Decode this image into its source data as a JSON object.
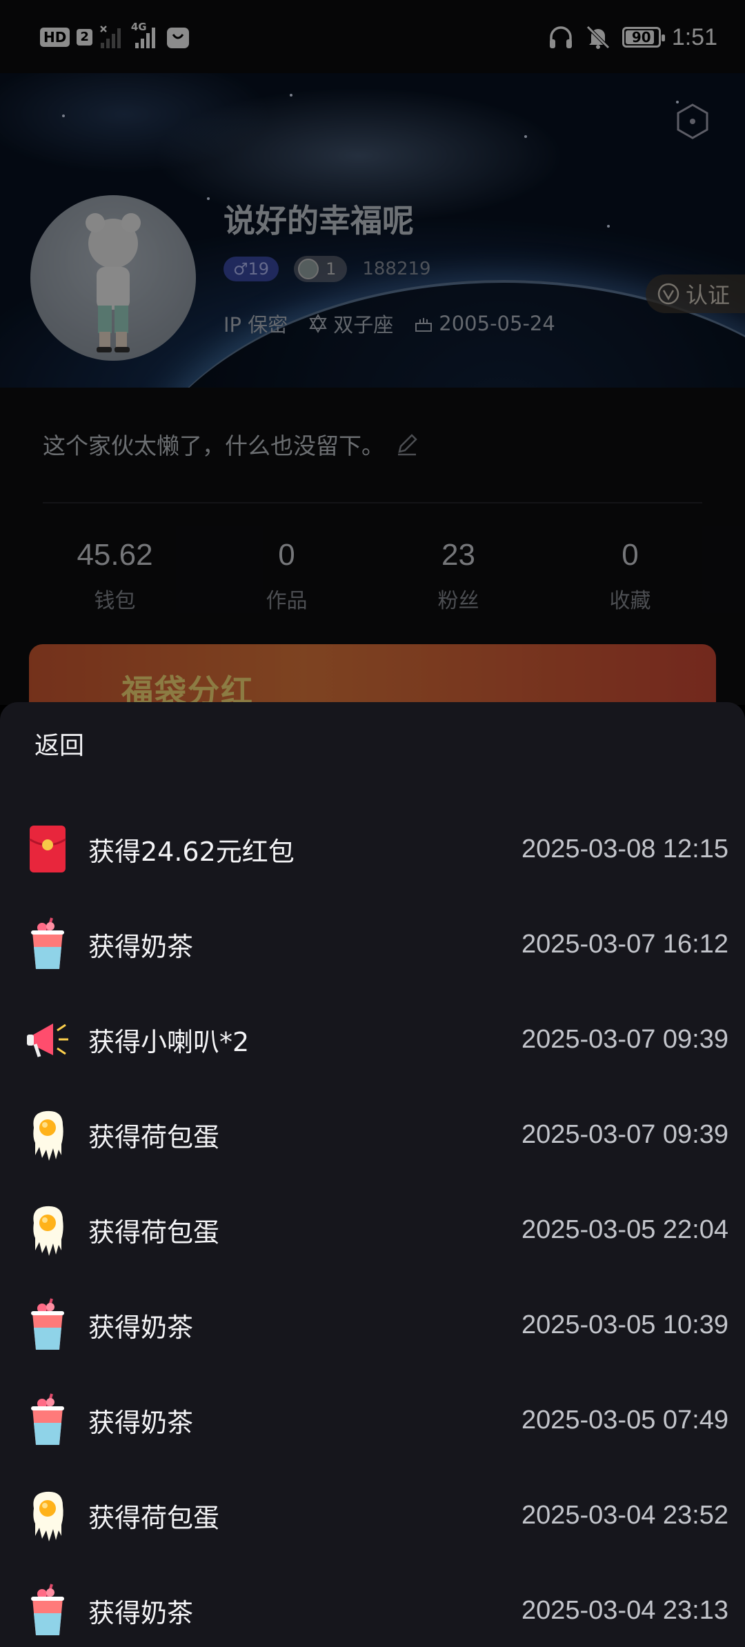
{
  "status_bar": {
    "hd": "HD",
    "sim": "2",
    "network": "4G",
    "battery": "90",
    "battery_level": 0.9,
    "time": "1:51"
  },
  "profile": {
    "nickname": "说好的幸福呢",
    "gender_age": "♂19",
    "level": "1",
    "user_id": "188219",
    "ip": "IP 保密",
    "zodiac": "双子座",
    "birthday": "2005-05-24",
    "verify_label": "认证",
    "bio": "这个家伙太懒了，什么也没留下。"
  },
  "stats": [
    {
      "value": "45.62",
      "label": "钱包"
    },
    {
      "value": "0",
      "label": "作品"
    },
    {
      "value": "23",
      "label": "粉丝"
    },
    {
      "value": "0",
      "label": "收藏"
    }
  ],
  "banner": {
    "title": "福袋分红"
  },
  "sheet": {
    "back_label": "返回",
    "records": [
      {
        "icon": "red-envelope",
        "title": "获得24.62元红包",
        "time": "2025-03-08 12:15"
      },
      {
        "icon": "milk-tea",
        "title": "获得奶茶",
        "time": "2025-03-07 16:12"
      },
      {
        "icon": "megaphone",
        "title": "获得小喇叭*2",
        "time": "2025-03-07 09:39"
      },
      {
        "icon": "fried-egg",
        "title": "获得荷包蛋",
        "time": "2025-03-07 09:39"
      },
      {
        "icon": "fried-egg",
        "title": "获得荷包蛋",
        "time": "2025-03-05 22:04"
      },
      {
        "icon": "milk-tea",
        "title": "获得奶茶",
        "time": "2025-03-05 10:39"
      },
      {
        "icon": "milk-tea",
        "title": "获得奶茶",
        "time": "2025-03-05 07:49"
      },
      {
        "icon": "fried-egg",
        "title": "获得荷包蛋",
        "time": "2025-03-04 23:52"
      },
      {
        "icon": "milk-tea",
        "title": "获得奶茶",
        "time": "2025-03-04 23:13"
      }
    ]
  }
}
